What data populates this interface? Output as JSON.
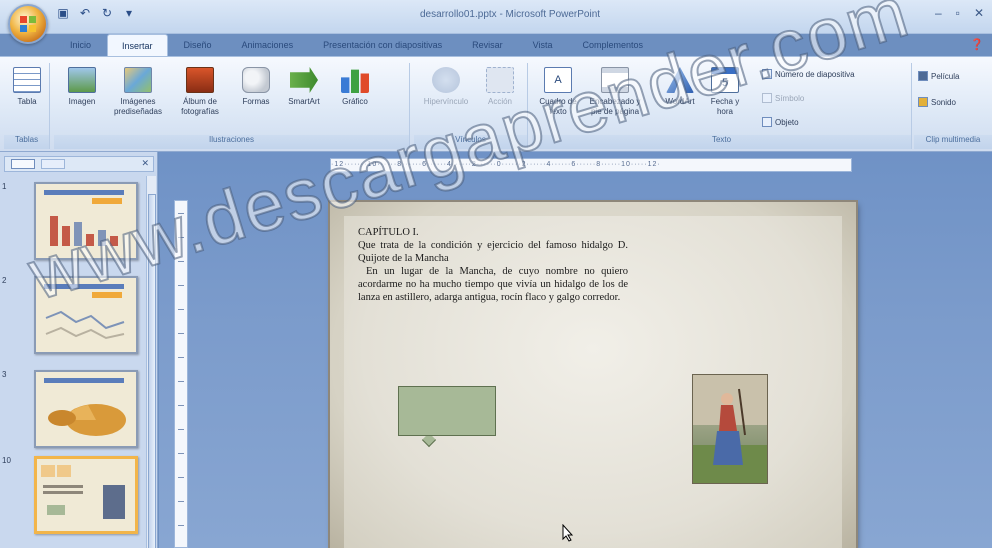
{
  "window": {
    "title": "desarrollo01.pptx - Microsoft PowerPoint",
    "minimize_label": "–",
    "maximize_label": "▫",
    "close_label": "✕"
  },
  "tabs": [
    {
      "label": "Inicio"
    },
    {
      "label": "Insertar",
      "active": true
    },
    {
      "label": "Diseño"
    },
    {
      "label": "Animaciones"
    },
    {
      "label": "Presentación con diapositivas"
    },
    {
      "label": "Revisar"
    },
    {
      "label": "Vista"
    },
    {
      "label": "Complementos"
    }
  ],
  "ribbon": {
    "groups": {
      "tables": "Tablas",
      "illustrations": "Ilustraciones",
      "links": "Vínculos",
      "text": "Texto",
      "media": "Clip multimedia"
    },
    "buttons": {
      "table": "Tabla",
      "image": "Imagen",
      "clip_art": "Imágenes prediseñadas",
      "photo_album": "Álbum de fotografías",
      "shapes": "Formas",
      "smartart": "SmartArt",
      "chart": "Gráfico",
      "hyperlink": "Hipervínculo",
      "action": "Acción",
      "text_box": "Cuadro de texto",
      "header_footer": "Encabezado y pie de página",
      "wordart": "WordArt",
      "date_time": "Fecha y hora",
      "slide_number": "Número de diapositiva",
      "symbol": "Símbolo",
      "object": "Objeto",
      "movie": "Película",
      "sound": "Sonido"
    }
  },
  "slides_panel": {
    "slides": [
      {
        "number": "1"
      },
      {
        "number": "2"
      },
      {
        "number": "3"
      },
      {
        "number": "10",
        "selected": true
      }
    ]
  },
  "ruler": {
    "horizontal": "·12·······10······8······6······4······2······0······2······4······6······8······10·····12·"
  },
  "slide": {
    "chapter_title": "CAPÍTULO I.",
    "chapter_subtitle": "Que trata de la condición y ejercicio del famoso hidalgo D. Quijote de la Mancha",
    "paragraph": "En un lugar de la Mancha, de cuyo nombre no quiero acordarme no ha mucho tiempo que vivía un hidalgo de los de lanza en astillero, adarga antigua, rocín flaco y galgo corredor."
  },
  "watermark": "www.descargaprender.com",
  "colors": {
    "ribbon_bg": "#dde8f6",
    "editing_bg": "#7b9bcb",
    "selection_border": "#f2b54a",
    "callout_fill": "#a7b997"
  }
}
